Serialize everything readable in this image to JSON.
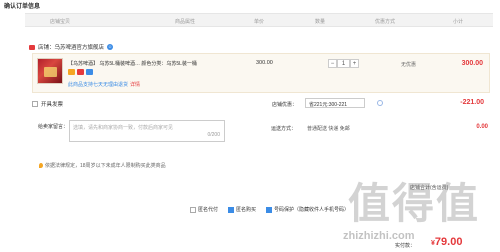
{
  "page_title": "确认订单信息",
  "columns": [
    "店铺宝贝",
    "商品属性",
    "单价",
    "数量",
    "优惠方式",
    "小计"
  ],
  "shop": {
    "label": "店铺：乌苏啤酒官方旗舰店"
  },
  "item": {
    "title": "【乌苏啤酒】 乌苏5L桶装啤酒… 颜色分类：乌苏5L装一桶",
    "return_note": "此商品支持七天无理由退货",
    "return_detail": "详情",
    "price": "300.00",
    "quantity": "1",
    "qty_minus": "−",
    "qty_plus": "+",
    "promo": "无优惠",
    "subtotal": "300.00"
  },
  "invoice": {
    "label": "开具发票"
  },
  "coupon": {
    "label": "店铺优惠：",
    "value": "省221元:300-221",
    "discount": "-221.00"
  },
  "remark": {
    "label": "给卖家留言：",
    "placeholder": "选填，请先和商家协商一致，付款后商家可见",
    "count": "0/200"
  },
  "shipping": {
    "label": "运送方式：",
    "method": "普通配送 快递 免邮",
    "fee": "0.00"
  },
  "legal_note": "依据法律规定，18周岁以下未成年人限制购买此类商品",
  "summary": "店铺合计(含运费)",
  "options": [
    {
      "label": "匿名代付",
      "checked": false
    },
    {
      "label": "匿名购买",
      "checked": true
    },
    {
      "label": "号码保护（隐藏收件人手机号码）",
      "checked": true
    }
  ],
  "payment": {
    "label": "实付款：",
    "currency": "¥",
    "amount": "79.00"
  },
  "watermark": {
    "text": "值得值",
    "url": "zhizhizhi.com"
  }
}
